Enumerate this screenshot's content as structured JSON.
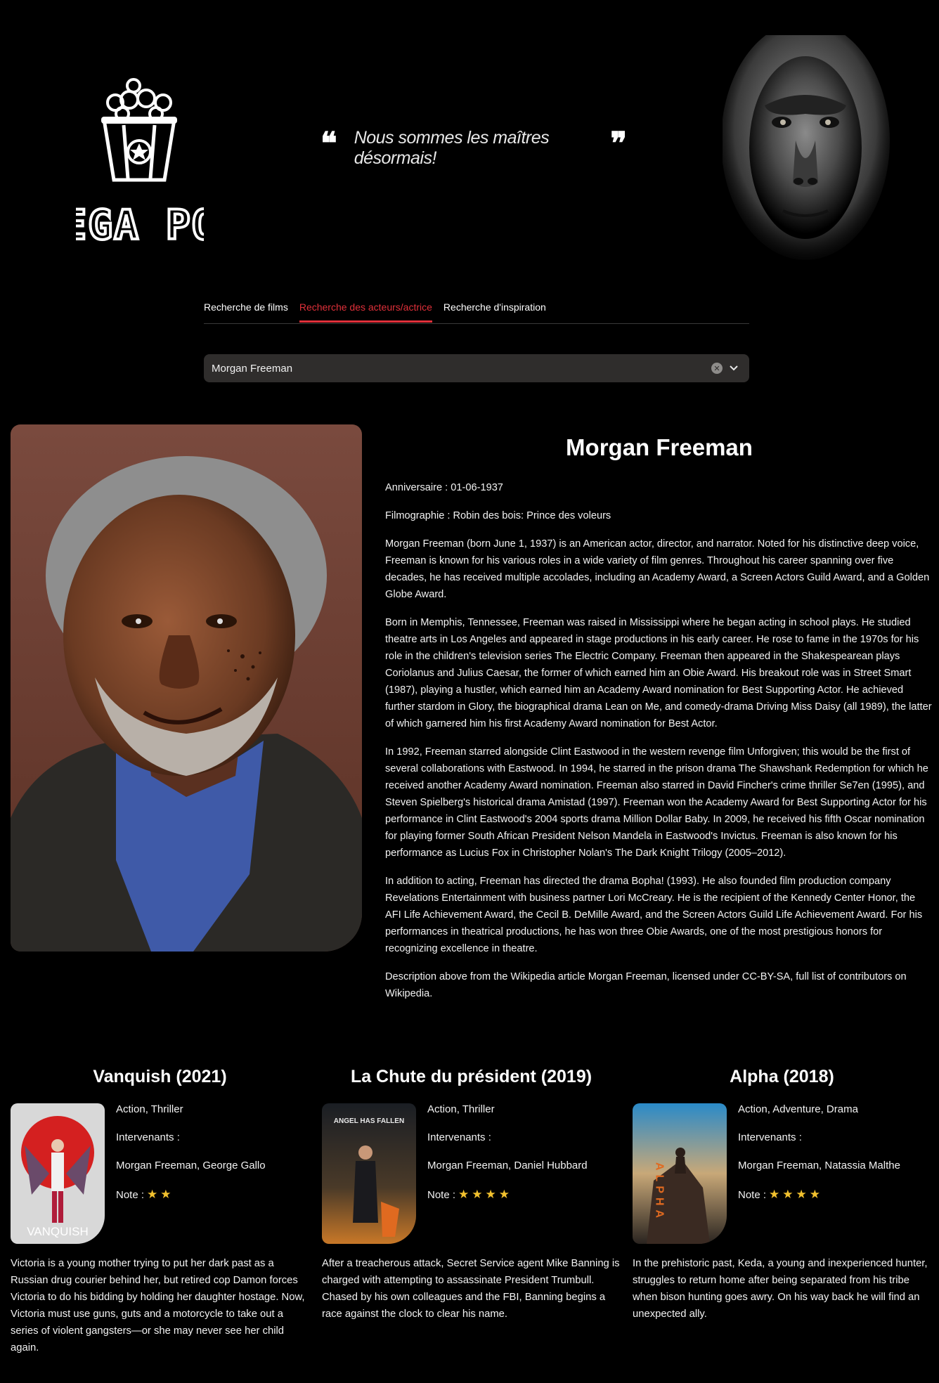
{
  "header": {
    "logo_text": "MEGA POP",
    "quote": "Nous sommes les maîtres désormais!",
    "quote_open": "❝",
    "quote_close": "❞"
  },
  "tabs": [
    {
      "label": "Recherche de films",
      "active": false
    },
    {
      "label": "Recherche des acteurs/actrice",
      "active": true
    },
    {
      "label": "Recherche d'inspiration",
      "active": false
    }
  ],
  "search": {
    "value": "Morgan Freeman",
    "clear_icon": "clear-icon",
    "dropdown_icon": "chevron-down-icon"
  },
  "actor": {
    "name": "Morgan Freeman",
    "birthday": "Anniversaire : 01-06-1937",
    "filmography": "Filmographie : Robin des bois: Prince des voleurs",
    "bio": [
      "Morgan Freeman (born June 1, 1937) is an American actor, director, and narrator. Noted for his distinctive deep voice, Freeman is known for his various roles in a wide variety of film genres. Throughout his career spanning over five decades, he has received multiple accolades, including an Academy Award, a Screen Actors Guild Award, and a Golden Globe Award.",
      "Born in Memphis, Tennessee, Freeman was raised in Mississippi where he began acting in school plays. He studied theatre arts in Los Angeles and appeared in stage productions in his early career. He rose to fame in the 1970s for his role in the children's television series The Electric Company. Freeman then appeared in the Shakespearean plays Coriolanus and Julius Caesar, the former of which earned him an Obie Award. His breakout role was in Street Smart (1987), playing a hustler, which earned him an Academy Award nomination for Best Supporting Actor. He achieved further stardom in Glory, the biographical drama Lean on Me, and comedy-drama Driving Miss Daisy (all 1989), the latter of which garnered him his first Academy Award nomination for Best Actor.",
      "In 1992, Freeman starred alongside Clint Eastwood in the western revenge film Unforgiven; this would be the first of several collaborations with Eastwood. In 1994, he starred in the prison drama The Shawshank Redemption for which he received another Academy Award nomination. Freeman also starred in David Fincher's crime thriller Se7en (1995), and Steven Spielberg's historical drama Amistad (1997). Freeman won the Academy Award for Best Supporting Actor for his performance in Clint Eastwood's 2004 sports drama Million Dollar Baby. In 2009, he received his fifth Oscar nomination for playing former South African President Nelson Mandela in Eastwood's Invictus. Freeman is also known for his performance as Lucius Fox in Christopher Nolan's The Dark Knight Trilogy (2005–2012).",
      "In addition to acting, Freeman has directed the drama Bopha! (1993). He also founded film production company Revelations Entertainment with business partner Lori McCreary. He is the recipient of the Kennedy Center Honor, the AFI Life Achievement Award, the Cecil B. DeMille Award, and the Screen Actors Guild Life Achievement Award. For his performances in theatrical productions, he has won three Obie Awards, one of the most prestigious honors for recognizing excellence in theatre.",
      "Description above from the Wikipedia article Morgan Freeman, licensed under CC-BY-SA, full list of contributors on Wikipedia."
    ]
  },
  "movies": [
    {
      "title": "Vanquish (2021)",
      "genres": "Action, Thriller",
      "cast_label": "Intervenants :",
      "cast": "Morgan Freeman, George Gallo",
      "rating_label": "Note :",
      "stars": 2,
      "poster_text": "VANQUISH",
      "synopsis": "Victoria is a young mother trying to put her dark past as a Russian drug courier behind her, but retired cop Damon forces Victoria to do his bidding by holding her daughter hostage. Now, Victoria must use guns, guts and a motorcycle to take out a series of violent gangsters—or she may never see her child again."
    },
    {
      "title": "La Chute du président (2019)",
      "genres": "Action, Thriller",
      "cast_label": "Intervenants :",
      "cast": "Morgan Freeman, Daniel Hubbard",
      "rating_label": "Note :",
      "stars": 4,
      "poster_text": "ANGEL HAS FALLEN",
      "synopsis": "After a treacherous attack, Secret Service agent Mike Banning is charged with attempting to assassinate President Trumbull. Chased by his own colleagues and the FBI, Banning begins a race against the clock to clear his name."
    },
    {
      "title": "Alpha (2018)",
      "genres": "Action, Adventure, Drama",
      "cast_label": "Intervenants :",
      "cast": "Morgan Freeman, Natassia Malthe",
      "rating_label": "Note :",
      "stars": 4,
      "poster_text": "ALPHA",
      "synopsis": "In the prehistoric past, Keda, a young and inexperienced hunter, struggles to return home after being separated from his tribe when bison hunting goes awry. On his way back he will find an unexpected ally."
    }
  ]
}
